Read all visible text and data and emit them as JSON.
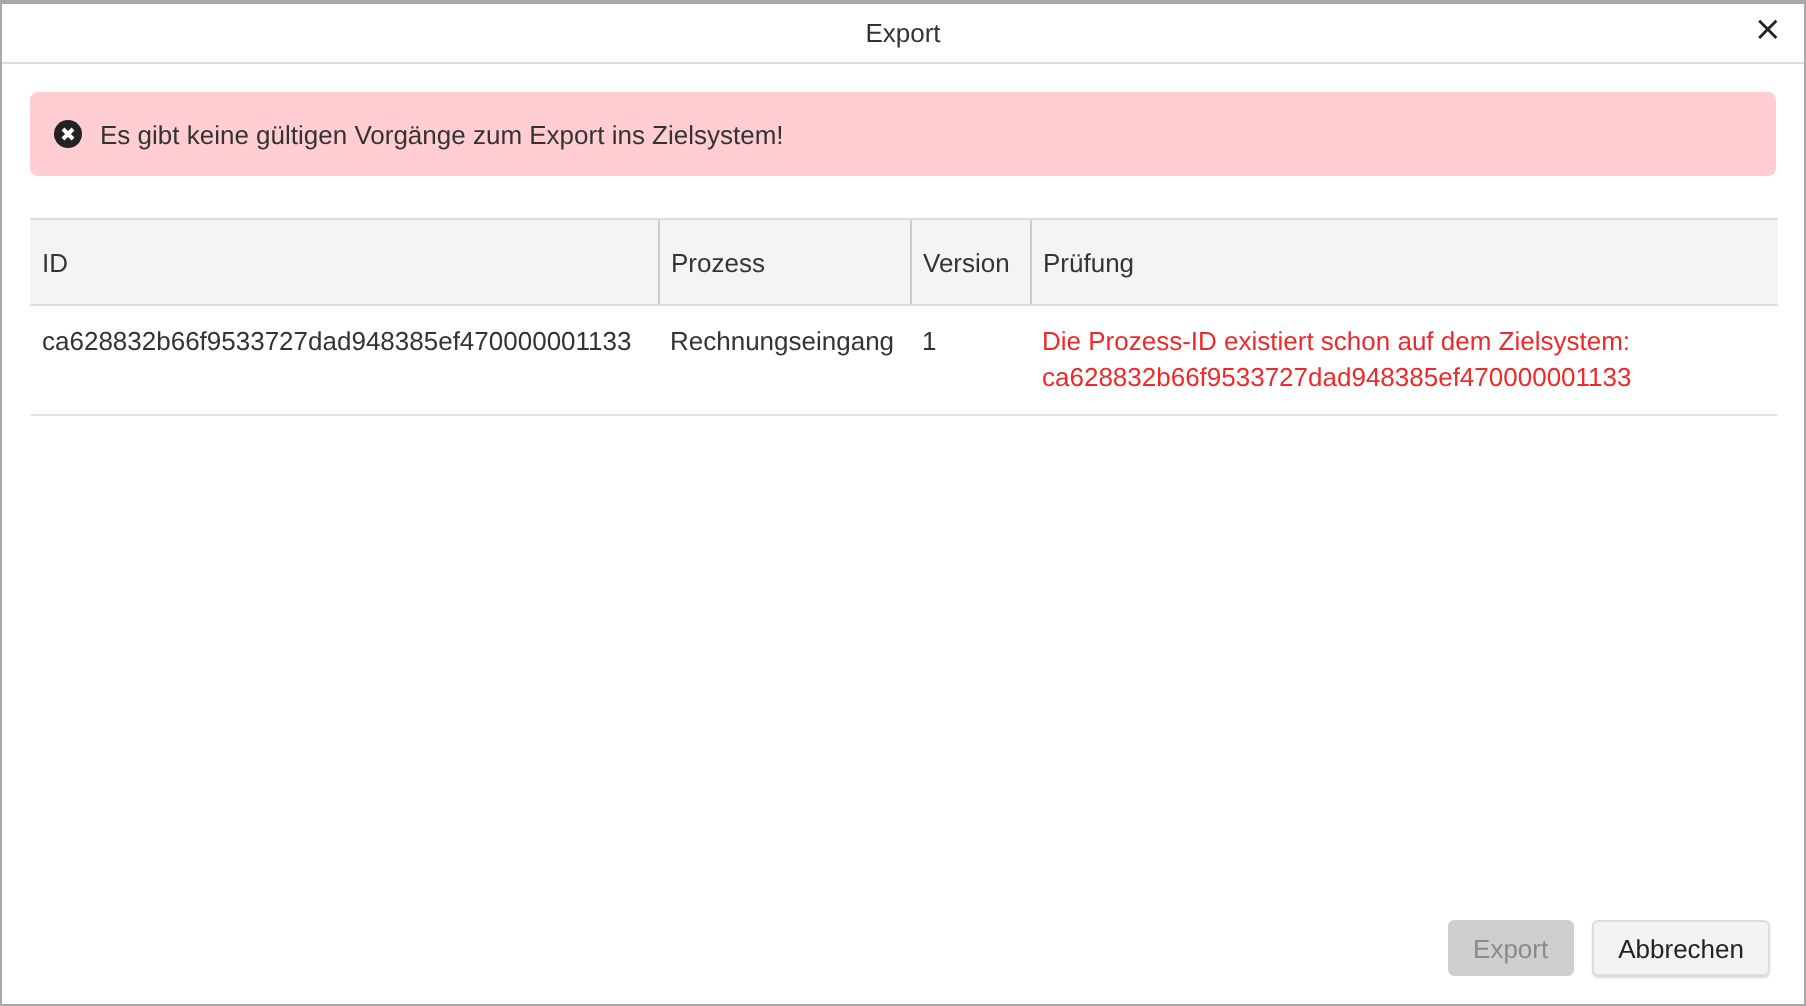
{
  "window": {
    "title": "Export",
    "close": "×"
  },
  "alert": {
    "kind": "error",
    "text": "Es gibt keine gültigen Vorgänge zum Export ins Zielsystem!"
  },
  "table": {
    "columns": [
      "ID",
      "Prozess",
      "Version",
      "Prüfung"
    ],
    "rows": [
      {
        "id": "ca628832b66f9533727dad948385ef470000001133",
        "process": "Rechnungseingang",
        "version": "1",
        "check": {
          "error": true,
          "text": "Die Prozess-ID existiert schon auf dem Zielsystem: ca628832b66f9533727dad948385ef470000001133"
        }
      }
    ]
  },
  "buttons": [
    {
      "label": "Export",
      "disabled": true
    },
    {
      "label": "Abbrechen",
      "disabled": false
    }
  ]
}
